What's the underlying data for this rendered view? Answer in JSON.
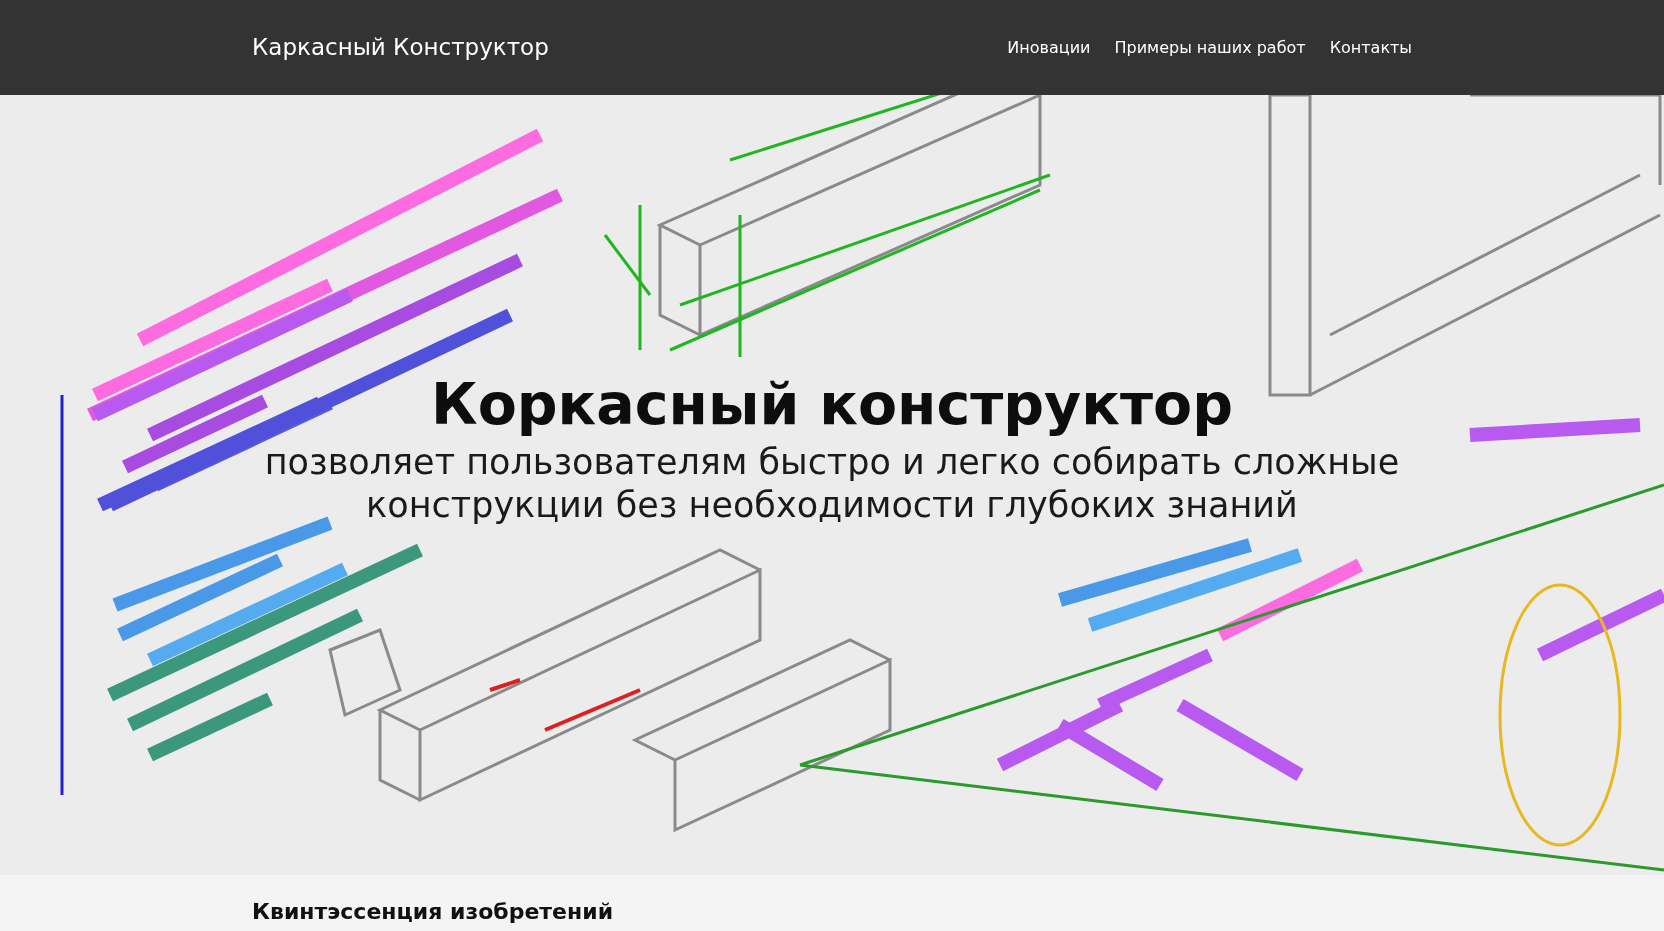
{
  "navbar": {
    "brand": "Каркасный Конструктор",
    "links": [
      {
        "label": "Иновации"
      },
      {
        "label": "Примеры наших работ"
      },
      {
        "label": "Контакты"
      }
    ]
  },
  "hero": {
    "title": "Коркасный конструктор",
    "subtitle": "позволяет пользователям быстро и легко собирать сложные конструкции без необходимости глубоких знаний"
  },
  "section": {
    "heading": "Квинтэссенция изобретений"
  }
}
